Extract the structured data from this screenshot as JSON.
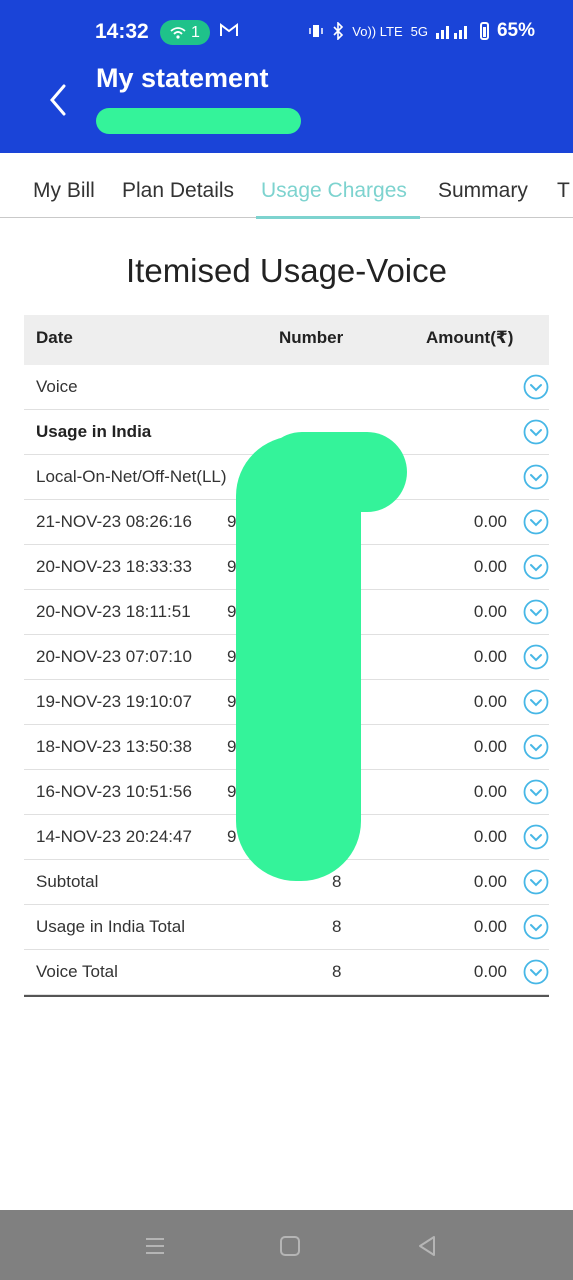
{
  "status_bar": {
    "time": "14:32",
    "wifi_count": "1",
    "battery": "65%",
    "volte": "Vo)) LTE",
    "net": "5G"
  },
  "header": {
    "title": "My statement",
    "back_icon": "chevron-left-icon"
  },
  "tabs": [
    {
      "label": "My Bill"
    },
    {
      "label": "Plan Details"
    },
    {
      "label": "Usage Charges",
      "active": true
    },
    {
      "label": "Summary"
    },
    {
      "label": "T"
    }
  ],
  "section_title": "Itemised Usage-Voice",
  "table": {
    "headers": {
      "date": "Date",
      "number": "Number",
      "amount": "Amount(₹)"
    },
    "rows": [
      {
        "date": "Voice",
        "number": "",
        "amount": ""
      },
      {
        "date": "Usage in India",
        "number": "",
        "amount": ""
      },
      {
        "date": "Local-On-Net/Off-Net(LL)",
        "number": "",
        "amount": ""
      },
      {
        "date": "21-NOV-23 08:26:16",
        "number": "9",
        "amount": "0.00"
      },
      {
        "date": "20-NOV-23 18:33:33",
        "number": "9",
        "amount": "0.00"
      },
      {
        "date": "20-NOV-23 18:11:51",
        "number": "9",
        "amount": "0.00"
      },
      {
        "date": "20-NOV-23 07:07:10",
        "number": "9",
        "amount": "0.00"
      },
      {
        "date": "19-NOV-23 19:10:07",
        "number": "9",
        "amount": "0.00"
      },
      {
        "date": "18-NOV-23 13:50:38",
        "number": "9",
        "amount": "0.00"
      },
      {
        "date": "16-NOV-23 10:51:56",
        "number": "9",
        "amount": "0.00"
      },
      {
        "date": "14-NOV-23 20:24:47",
        "number": "9",
        "amount": "0.00"
      },
      {
        "date": "Subtotal",
        "number": "8",
        "amount": "0.00"
      },
      {
        "date": "Usage in India Total",
        "number": "8",
        "amount": "0.00"
      },
      {
        "date": "Voice Total",
        "number": "8",
        "amount": "0.00"
      }
    ]
  },
  "colors": {
    "header_bg": "#1a44d8",
    "accent": "#7dd3cf",
    "redaction": "#34f39a",
    "chevron": "#47b7e6",
    "navbar": "#808080"
  }
}
